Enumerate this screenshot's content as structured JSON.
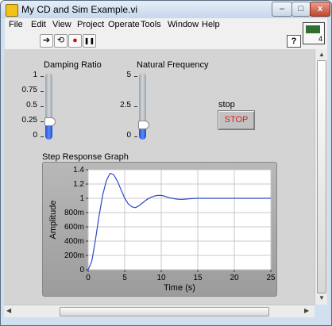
{
  "window": {
    "title": "My CD and Sim Example.vi",
    "minimize_glyph": "–",
    "maximize_glyph": "□",
    "close_glyph": "x"
  },
  "menu": [
    "File",
    "Edit",
    "View",
    "Project",
    "Operate",
    "Tools",
    "Window",
    "Help"
  ],
  "toolbar": {
    "run_glyph": "➔",
    "run_continuous_glyph": "⟲",
    "abort_glyph": "●",
    "pause_glyph": "❚❚",
    "help_glyph": "?",
    "vi_icon_number": "4"
  },
  "controls": {
    "damping": {
      "label": "Damping Ratio",
      "ticks": [
        "1",
        "0.75",
        "0.5",
        "0.25",
        "0"
      ],
      "min": 0,
      "max": 1,
      "value": 0.25
    },
    "frequency": {
      "label": "Natural Frequency",
      "ticks": [
        "5",
        "2.5",
        "0"
      ],
      "min": 0,
      "max": 5,
      "value": 1
    },
    "stop": {
      "label": "stop",
      "button_text": "STOP"
    }
  },
  "colors": {
    "panel": "#d4d4d4",
    "plot_background": "#ffffff",
    "grid": "#c8c8c8",
    "trace": "#2a4ac8",
    "fill": "#2f62e8",
    "stop_text": "#e21818"
  },
  "chart_data": {
    "type": "line",
    "title": "Step Response Graph",
    "xlabel": "Time (s)",
    "ylabel": "Amplitude",
    "xlim": [
      0,
      25
    ],
    "ylim": [
      0,
      1.4
    ],
    "xticks": [
      "0",
      "5",
      "10",
      "15",
      "20",
      "25"
    ],
    "yticks": [
      "0",
      "200m",
      "400m",
      "600m",
      "800m",
      "1",
      "1.2",
      "1.4"
    ],
    "grid": true,
    "series": [
      {
        "x": [
          0,
          0.5,
          1,
          1.5,
          2,
          2.5,
          3,
          3.5,
          4,
          4.5,
          5,
          5.5,
          6,
          6.5,
          7,
          7.5,
          8,
          8.5,
          9,
          9.5,
          10,
          10.5,
          11,
          11.5,
          12,
          12.5,
          13,
          13.5,
          14,
          15,
          16,
          17,
          18,
          19,
          20,
          21,
          22,
          23,
          24,
          25
        ],
        "y": [
          0,
          0.12,
          0.42,
          0.76,
          1.05,
          1.25,
          1.35,
          1.33,
          1.24,
          1.12,
          1.0,
          0.92,
          0.88,
          0.87,
          0.9,
          0.94,
          0.98,
          1.01,
          1.03,
          1.04,
          1.04,
          1.03,
          1.01,
          1.0,
          0.99,
          0.985,
          0.985,
          0.99,
          0.995,
          1.0,
          1.0,
          1.0,
          1.0,
          1.0,
          1.0,
          1.0,
          1.0,
          1.0,
          1.0,
          1.0
        ]
      }
    ]
  }
}
